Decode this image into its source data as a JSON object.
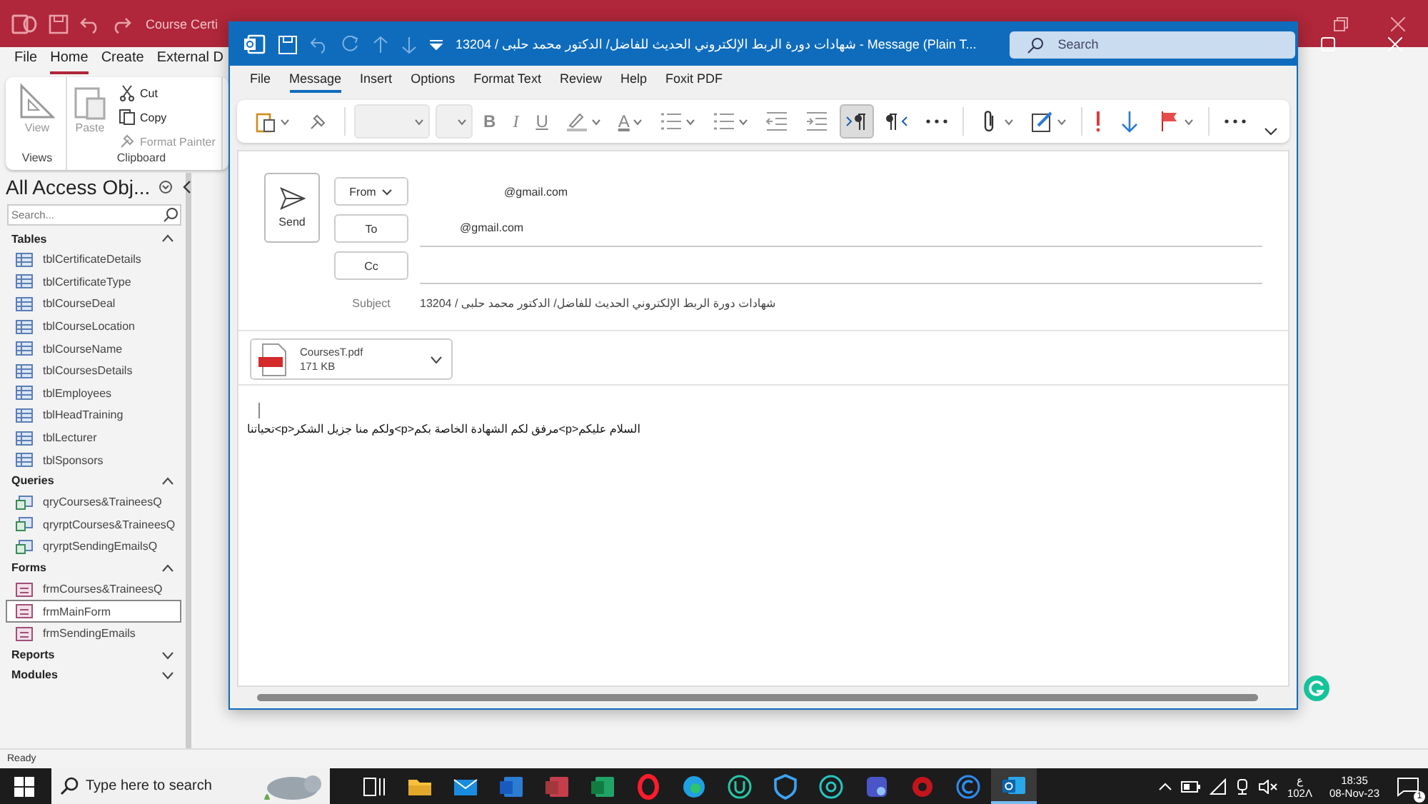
{
  "access": {
    "title": "Course Certi",
    "tabs": [
      {
        "label": "File",
        "selected": false
      },
      {
        "label": "Home",
        "selected": true
      },
      {
        "label": "Create",
        "selected": false
      },
      {
        "label": "External D",
        "selected": false
      }
    ],
    "ribbon": {
      "view": {
        "label": "View",
        "disabled": true
      },
      "paste": {
        "label": "Paste",
        "disabled": true
      },
      "cut": "Cut",
      "copy": "Copy",
      "format_painter": {
        "label": "Format Painter",
        "disabled": true
      },
      "groups": [
        "Views",
        "Clipboard"
      ]
    },
    "nav": {
      "title": "All Access Obj...",
      "search_placeholder": "Search...",
      "groups": [
        {
          "name": "Tables",
          "expanded": true,
          "items": [
            {
              "label": "tblCertificateDetails",
              "kind": "table",
              "selected": false
            },
            {
              "label": "tblCertificateType",
              "kind": "table",
              "selected": false
            },
            {
              "label": "tblCourseDeal",
              "kind": "table",
              "selected": false
            },
            {
              "label": "tblCourseLocation",
              "kind": "table",
              "selected": false
            },
            {
              "label": "tblCourseName",
              "kind": "table",
              "selected": false
            },
            {
              "label": "tblCoursesDetails",
              "kind": "table",
              "selected": false
            },
            {
              "label": "tblEmployees",
              "kind": "table",
              "selected": false
            },
            {
              "label": "tblHeadTraining",
              "kind": "table",
              "selected": false
            },
            {
              "label": "tblLecturer",
              "kind": "table",
              "selected": false
            },
            {
              "label": "tblSponsors",
              "kind": "table",
              "selected": false
            }
          ]
        },
        {
          "name": "Queries",
          "expanded": true,
          "items": [
            {
              "label": "qryCourses&TraineesQ",
              "kind": "query",
              "selected": false
            },
            {
              "label": "qryrptCourses&TraineesQ",
              "kind": "query",
              "selected": false
            },
            {
              "label": "qryrptSendingEmailsQ",
              "kind": "query",
              "selected": false
            }
          ]
        },
        {
          "name": "Forms",
          "expanded": true,
          "items": [
            {
              "label": "frmCourses&TraineesQ",
              "kind": "form",
              "selected": false
            },
            {
              "label": "frmMainForm",
              "kind": "form",
              "selected": true
            },
            {
              "label": "frmSendingEmails",
              "kind": "form",
              "selected": false
            }
          ]
        },
        {
          "name": "Reports",
          "expanded": false
        },
        {
          "name": "Modules",
          "expanded": false
        }
      ]
    },
    "status": "Ready"
  },
  "outlook": {
    "title": "شهادات دورة الربط الإلكتروني الحديث للفاضل/ الدكتور محمد حلبى / 13204 - Message (Plain T...",
    "search_placeholder": "Search",
    "tabs": [
      {
        "label": "File",
        "selected": false
      },
      {
        "label": "Message",
        "selected": true
      },
      {
        "label": "Insert",
        "selected": false
      },
      {
        "label": "Options",
        "selected": false
      },
      {
        "label": "Format Text",
        "selected": false
      },
      {
        "label": "Review",
        "selected": false
      },
      {
        "label": "Help",
        "selected": false
      },
      {
        "label": "Foxit PDF",
        "selected": false
      }
    ],
    "toolbar": [
      {
        "kind": "paste"
      },
      {
        "kind": "painter"
      },
      {
        "kind": "sep"
      },
      {
        "kind": "font"
      },
      {
        "kind": "size"
      },
      {
        "kind": "bold",
        "label": "B"
      },
      {
        "kind": "italic",
        "label": "I"
      },
      {
        "kind": "underline",
        "label": "U"
      },
      {
        "kind": "highlight"
      },
      {
        "kind": "color",
        "label": "A"
      },
      {
        "kind": "bullets"
      },
      {
        "kind": "numbering"
      },
      {
        "kind": "outdent"
      },
      {
        "kind": "indent"
      },
      {
        "kind": "ltr",
        "pressed": true
      },
      {
        "kind": "rtl",
        "pressed": false
      },
      {
        "kind": "more"
      },
      {
        "kind": "sep"
      },
      {
        "kind": "attach"
      },
      {
        "kind": "signature"
      },
      {
        "kind": "sep"
      },
      {
        "kind": "high"
      },
      {
        "kind": "low"
      },
      {
        "kind": "flag"
      },
      {
        "kind": "sep"
      },
      {
        "kind": "more"
      }
    ],
    "send": "Send",
    "from_label": "From",
    "from_value": "@gmail.com",
    "to_label": "To",
    "to_value": "@gmail.com",
    "cc_label": "Cc",
    "subject_label": "Subject",
    "subject": "شهادات دورة الربط الإلكتروني الحديث للفاضل/ الدكتور محمد حلبى / 13204",
    "attachment": {
      "name": "CoursesT.pdf",
      "size": "171 KB"
    },
    "body": "السلام عليكم<p>مرفق لكم الشهادة الخاصة بكم<p>ولكم منا جزيل الشكر<p>تحياتنا"
  },
  "taskbar": {
    "search_placeholder": "Type here to search",
    "apps": [
      {
        "kind": "taskview",
        "active": false
      },
      {
        "kind": "folder",
        "active": false
      },
      {
        "kind": "mail",
        "active": false
      },
      {
        "kind": "word",
        "active": false
      },
      {
        "kind": "access",
        "active": false
      },
      {
        "kind": "excel",
        "active": false
      },
      {
        "kind": "opera",
        "active": false
      },
      {
        "kind": "edge",
        "active": false
      },
      {
        "kind": "u",
        "active": false
      },
      {
        "kind": "shield",
        "active": false
      },
      {
        "kind": "b",
        "active": false
      },
      {
        "kind": "app",
        "active": false
      },
      {
        "kind": "gear",
        "active": false
      },
      {
        "kind": "c",
        "active": false
      },
      {
        "kind": "outlook",
        "active": true
      }
    ],
    "lang": "ع",
    "lang2": "102Λ",
    "time": "18:35",
    "date": "08-Nov-23",
    "notifications": "1"
  }
}
